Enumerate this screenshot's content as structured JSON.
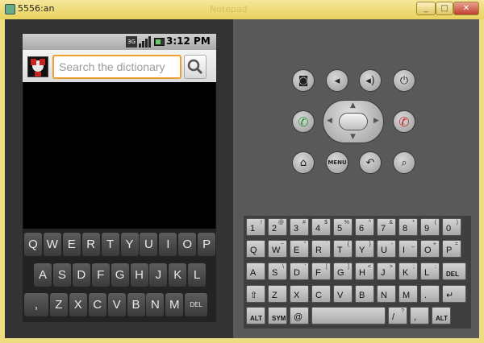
{
  "window": {
    "title": "5556:an",
    "faded_title": "Notepad",
    "minimize": "_",
    "maximize": "□",
    "close": "✕"
  },
  "status_bar": {
    "network": "3G",
    "time": "3:12 PM"
  },
  "search": {
    "placeholder": "Search the dictionary",
    "value": ""
  },
  "soft_keyboard": {
    "row1": [
      "Q",
      "W",
      "E",
      "R",
      "T",
      "Y",
      "U",
      "I",
      "O",
      "P"
    ],
    "row2": [
      "A",
      "S",
      "D",
      "F",
      "G",
      "H",
      "J",
      "K",
      "L"
    ],
    "row3": [
      ",",
      "Z",
      "X",
      "C",
      "V",
      "B",
      "N",
      "M",
      "DEL"
    ]
  },
  "controls": {
    "camera": "camera-icon",
    "volume_down": "volume-down-icon",
    "volume_up": "volume-up-icon",
    "power": "power-icon",
    "call": "call-icon",
    "end_call": "end-call-icon",
    "home": "home-icon",
    "menu": "MENU",
    "back": "back-icon",
    "search": "search-icon"
  },
  "hw_keyboard": {
    "row1": [
      {
        "k": "1",
        "a": "!"
      },
      {
        "k": "2",
        "a": "@"
      },
      {
        "k": "3",
        "a": "#"
      },
      {
        "k": "4",
        "a": "$"
      },
      {
        "k": "5",
        "a": "%"
      },
      {
        "k": "6",
        "a": "^"
      },
      {
        "k": "7",
        "a": "&"
      },
      {
        "k": "8",
        "a": "*"
      },
      {
        "k": "9",
        "a": "("
      },
      {
        "k": "0",
        "a": ")"
      }
    ],
    "row2": [
      {
        "k": "Q",
        "a": ""
      },
      {
        "k": "W",
        "a": "~"
      },
      {
        "k": "E",
        "a": "\""
      },
      {
        "k": "R",
        "a": "`"
      },
      {
        "k": "T",
        "a": "{"
      },
      {
        "k": "Y",
        "a": "}"
      },
      {
        "k": "U",
        "a": "-"
      },
      {
        "k": "I",
        "a": "_"
      },
      {
        "k": "O",
        "a": "+"
      },
      {
        "k": "P",
        "a": "="
      }
    ],
    "row3": [
      {
        "k": "A",
        "a": ""
      },
      {
        "k": "S",
        "a": "\\"
      },
      {
        "k": "D",
        "a": "'"
      },
      {
        "k": "F",
        "a": "["
      },
      {
        "k": "G",
        "a": "]"
      },
      {
        "k": "H",
        "a": "<"
      },
      {
        "k": "J",
        "a": ">"
      },
      {
        "k": "K",
        "a": ";"
      },
      {
        "k": "L",
        "a": ":"
      },
      {
        "k": "DEL",
        "a": ""
      }
    ],
    "row4": [
      {
        "k": "⇧",
        "a": ""
      },
      {
        "k": "Z",
        "a": ""
      },
      {
        "k": "X",
        "a": ""
      },
      {
        "k": "C",
        "a": ""
      },
      {
        "k": "V",
        "a": ""
      },
      {
        "k": "B",
        "a": ""
      },
      {
        "k": "N",
        "a": ""
      },
      {
        "k": "M",
        "a": ""
      },
      {
        "k": ".",
        "a": ""
      },
      {
        "k": "↵",
        "a": ""
      }
    ],
    "row5": [
      {
        "k": "ALT",
        "a": ""
      },
      {
        "k": "SYM",
        "a": ""
      },
      {
        "k": "@",
        "a": ""
      },
      {
        "k": "",
        "a": ""
      },
      {
        "k": "/",
        "a": "?"
      },
      {
        "k": ",",
        "a": ""
      },
      {
        "k": "ALT",
        "a": ""
      }
    ]
  },
  "colors": {
    "accent": "#f0a030",
    "call_green": "#2c9a3c",
    "end_red": "#c0302a"
  }
}
